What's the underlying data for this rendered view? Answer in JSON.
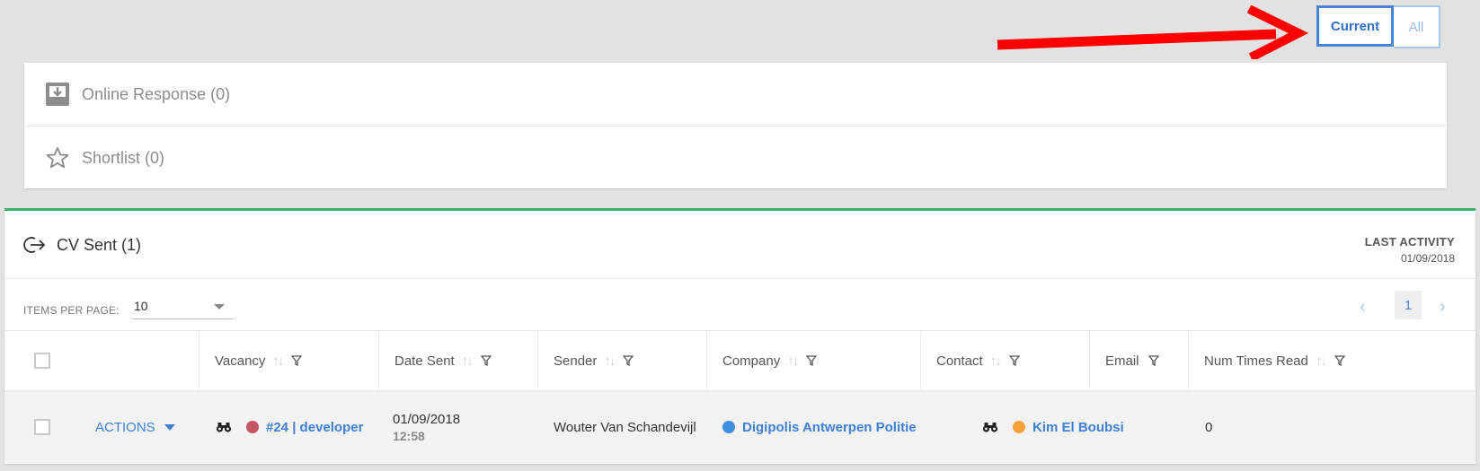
{
  "toggle": {
    "current_label": "Current",
    "all_label": "All"
  },
  "summary": [
    {
      "label": "Online Response (0)",
      "icon": "inbox-download-icon"
    },
    {
      "label": "Shortlist (0)",
      "icon": "star-outline-icon"
    }
  ],
  "cv_panel": {
    "title": "CV Sent (1)",
    "icon": "sign-out-arrow-icon",
    "last_activity_label": "LAST ACTIVITY",
    "last_activity_date": "01/09/2018",
    "items_per_page_label": "ITEMS PER PAGE:",
    "items_per_page_value": "10",
    "current_page": "1"
  },
  "columns": [
    {
      "label": "Vacancy",
      "sortable": true
    },
    {
      "label": "Date Sent",
      "sortable": true
    },
    {
      "label": "Sender",
      "sortable": true
    },
    {
      "label": "Company",
      "sortable": true
    },
    {
      "label": "Contact",
      "sortable": true
    },
    {
      "label": "Email",
      "sortable": false
    },
    {
      "label": "Num Times Read",
      "sortable": true
    }
  ],
  "row": {
    "actions_label": "ACTIONS",
    "vacancy": "#24 | developer",
    "date": "01/09/2018",
    "time": "12:58",
    "sender": "Wouter Van Schandevijl",
    "company": "Digipolis Antwerpen Politie",
    "contact": "Kim El Boubsi",
    "email": "",
    "num_times_read": "0"
  },
  "colors": {
    "accent": "#3f7fd4",
    "panel_top_border": "#39b56b",
    "vacancy_dot": "#c45462",
    "company_dot": "#3d8fe0",
    "contact_dot": "#f5a23a",
    "annotation_arrow": "#ff0000"
  }
}
